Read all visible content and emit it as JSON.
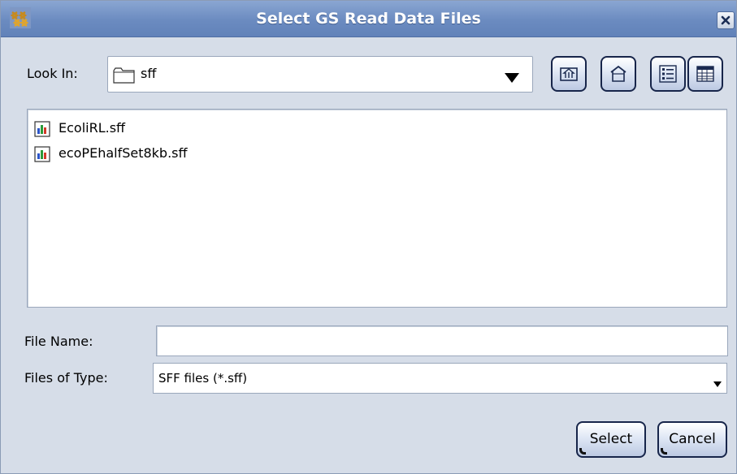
{
  "window": {
    "title": "Select GS Read Data Files",
    "close_label": "close"
  },
  "lookin": {
    "label": "Look In:",
    "value": "sff"
  },
  "toolbar": {
    "icons": [
      "up-folder-icon",
      "home-icon",
      "list-view-icon",
      "details-view-icon"
    ]
  },
  "files": [
    {
      "name": "EcoliRL.sff",
      "icon": "sff-file-icon"
    },
    {
      "name": "ecoPEhalfSet8kb.sff",
      "icon": "sff-file-icon"
    }
  ],
  "filename": {
    "label": "File Name:",
    "value": "",
    "placeholder": ""
  },
  "filetype": {
    "label": "Files of Type:",
    "value": "SFF files (*.sff)"
  },
  "buttons": {
    "select_label": "Select",
    "cancel_label": "Cancel"
  },
  "colors": {
    "titlebar": "#6b8bc0",
    "dialog_bg": "#d6dde8",
    "button_border": "#17254a"
  }
}
